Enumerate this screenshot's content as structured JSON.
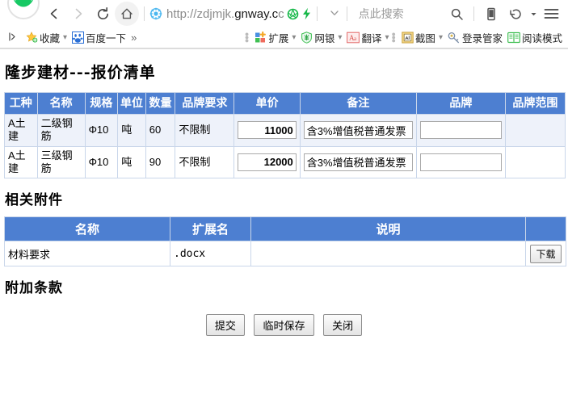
{
  "browser": {
    "url_prefix": "http://zdjmjk.",
    "url_domain": "gnway.c",
    "url_suffix": "c",
    "search_hint": "点此搜索",
    "bookmarks": [
      {
        "label": "收藏",
        "icon": "star-icon",
        "has_caret": true
      },
      {
        "label": "百度一下",
        "icon": "baidu-icon",
        "has_caret": false
      }
    ],
    "bookmarks_right": [
      {
        "label": "扩展",
        "icon": "extensions-icon",
        "has_caret": true
      },
      {
        "label": "网银",
        "icon": "bank-icon",
        "has_caret": true
      },
      {
        "label": "翻译",
        "icon": "translate-icon",
        "has_caret": true
      },
      {
        "label": "截图",
        "icon": "screenshot-icon",
        "has_caret": true
      },
      {
        "label": "登录管家",
        "icon": "key-icon",
        "has_caret": false
      },
      {
        "label": "阅读模式",
        "icon": "book-icon",
        "has_caret": false
      }
    ],
    "overflow_label": "»"
  },
  "page": {
    "title": "隆步建材---报价清单",
    "attachments_heading": "相关附件",
    "terms_heading": "附加条款"
  },
  "quote_table": {
    "headers": [
      "工种",
      "名称",
      "规格",
      "单位",
      "数量",
      "品牌要求",
      "单价",
      "备注",
      "品牌",
      "品牌范围"
    ],
    "rows": [
      {
        "trade": "A土建",
        "name": "二级钢筋",
        "spec": "Φ10",
        "unit": "吨",
        "qty": "60",
        "brand_req": "不限制",
        "price": "11000",
        "remark": "含3%增值税普通发票",
        "brand": "",
        "brand_scope": ""
      },
      {
        "trade": "A土建",
        "name": "三级钢筋",
        "spec": "Φ10",
        "unit": "吨",
        "qty": "90",
        "brand_req": "不限制",
        "price": "12000",
        "remark": "含3%增值税普通发票",
        "brand": "",
        "brand_scope": ""
      }
    ]
  },
  "attachments_table": {
    "headers": [
      "名称",
      "扩展名",
      "说明",
      ""
    ],
    "rows": [
      {
        "name": "材料要求",
        "ext": ".docx",
        "desc": "",
        "download_label": "下载"
      }
    ]
  },
  "buttons": {
    "submit": "提交",
    "temp_save": "临时保存",
    "close": "关闭"
  },
  "colors": {
    "header_blue": "#4d7fd1",
    "row_alt": "#eef2fa",
    "border": "#c9d6ea",
    "logo_green": "#17c964"
  }
}
